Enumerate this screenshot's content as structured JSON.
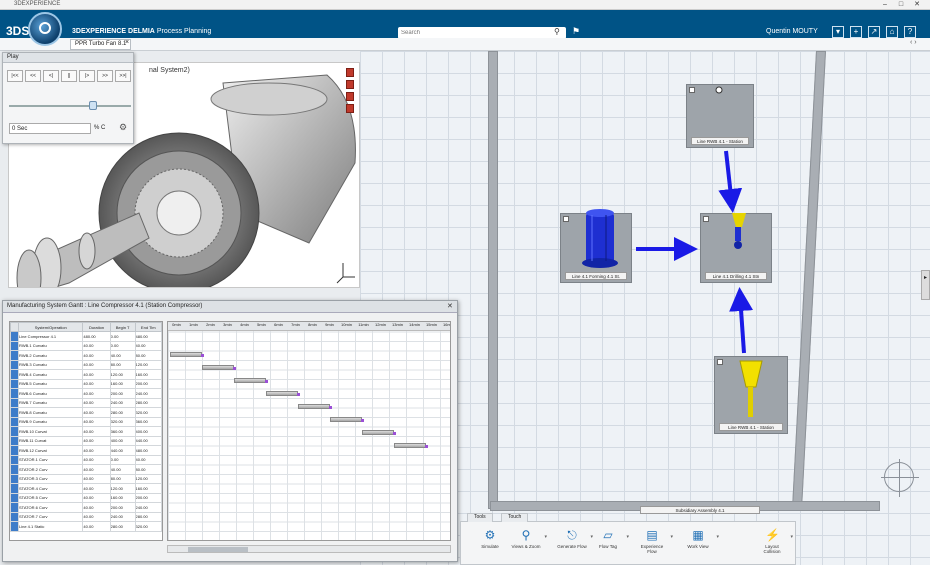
{
  "window": {
    "title": "3DEXPERIENCE",
    "controls": [
      "–",
      "□",
      "✕"
    ]
  },
  "app": {
    "logo": "3DS",
    "brand": "3DEXPERIENCE",
    "product": "DELMIA",
    "module": "Process Planning",
    "search_placeholder": "Search",
    "user": "Quentin MOUTY",
    "accent": "#005386"
  },
  "tab": {
    "label": "PPR Turbo Fan 8.1",
    "close": "×"
  },
  "viewer": {
    "caption": "nal System2)"
  },
  "play_panel": {
    "title": "Play",
    "buttons": [
      "|<<",
      "<<",
      "<|",
      "||",
      "|>",
      ">>",
      ">>|"
    ],
    "time_value": "0 Sec",
    "time_unit": "% C",
    "slider_fraction": 0.68
  },
  "gantt": {
    "title": "Manufacturing System Gantt : Line Compressor 4.1 (Station Compressor)",
    "columns": [
      "System/Operation",
      "Duration",
      "Begin T",
      "End Tim"
    ],
    "rows": [
      [
        "Line Compressor 4.1",
        "480.00",
        "0.00",
        "480.00"
      ],
      [
        "RWB.1 Curvatu",
        "40.00",
        "0.00",
        "40.00"
      ],
      [
        "RWB.2 Curvatu",
        "40.00",
        "40.00",
        "80.00"
      ],
      [
        "RWB.3 Curvatu",
        "40.00",
        "80.00",
        "120.00"
      ],
      [
        "RWB.4 Curvatu",
        "40.00",
        "120.00",
        "160.00"
      ],
      [
        "RWB.5 Curvatu",
        "40.00",
        "160.00",
        "200.00"
      ],
      [
        "RWB.6 Curvatu",
        "40.00",
        "200.00",
        "240.00"
      ],
      [
        "RWB.7 Curvatu",
        "40.00",
        "240.00",
        "280.00"
      ],
      [
        "RWB.8 Curvatu",
        "40.00",
        "280.00",
        "320.00"
      ],
      [
        "RWB.9 Curvatu",
        "40.00",
        "320.00",
        "360.00"
      ],
      [
        "RWB.10 Curvat",
        "40.00",
        "360.00",
        "400.00"
      ],
      [
        "RWB.11 Curvat",
        "40.00",
        "400.00",
        "440.00"
      ],
      [
        "RWB.12 Curvat",
        "40.00",
        "440.00",
        "480.00"
      ],
      [
        "STATOR.1 Curv",
        "40.00",
        "0.00",
        "40.00"
      ],
      [
        "STATOR.2 Curv",
        "40.00",
        "40.00",
        "80.00"
      ],
      [
        "STATOR.3 Curv",
        "40.00",
        "80.00",
        "120.00"
      ],
      [
        "STATOR.4 Curv",
        "40.00",
        "120.00",
        "160.00"
      ],
      [
        "STATOR.5 Curv",
        "40.00",
        "160.00",
        "200.00"
      ],
      [
        "STATOR.6 Curv",
        "40.00",
        "200.00",
        "240.00"
      ],
      [
        "STATOR.7 Curv",
        "40.00",
        "240.00",
        "280.00"
      ],
      [
        "Line 4.1 Static",
        "40.00",
        "280.00",
        "320.00"
      ]
    ],
    "timeline_ticks": [
      "0min",
      "1min",
      "2min",
      "3min",
      "4min",
      "5min",
      "6min",
      "7min",
      "8min",
      "9min",
      "10min",
      "11min",
      "12min",
      "13min",
      "14min",
      "15min",
      "16min"
    ],
    "bars": [
      {
        "begin": 0,
        "end": 40
      },
      {
        "begin": 40,
        "end": 80
      },
      {
        "begin": 80,
        "end": 120
      },
      {
        "begin": 120,
        "end": 160
      },
      {
        "begin": 160,
        "end": 200
      },
      {
        "begin": 200,
        "end": 240
      },
      {
        "begin": 240,
        "end": 280
      },
      {
        "begin": 280,
        "end": 320
      }
    ],
    "close": "✕"
  },
  "stations": {
    "top": "Line RWB 4.1 - Station",
    "left": "Line 4.1 Forming 4.1 St.",
    "center": "Line 4.1 Drilling 4.1 Stn",
    "bottom": "Line RWB 4.1 - Station",
    "bar_label": "Subsidiary Assembly 4.1"
  },
  "ribbon": {
    "tabs": [
      "Tools",
      "Touch"
    ],
    "buttons": [
      "Simulate",
      "Views & Zoom",
      "Generate Flow",
      "Flow Tag",
      "Experience Flow",
      "Work View",
      "Layout Collision"
    ]
  }
}
